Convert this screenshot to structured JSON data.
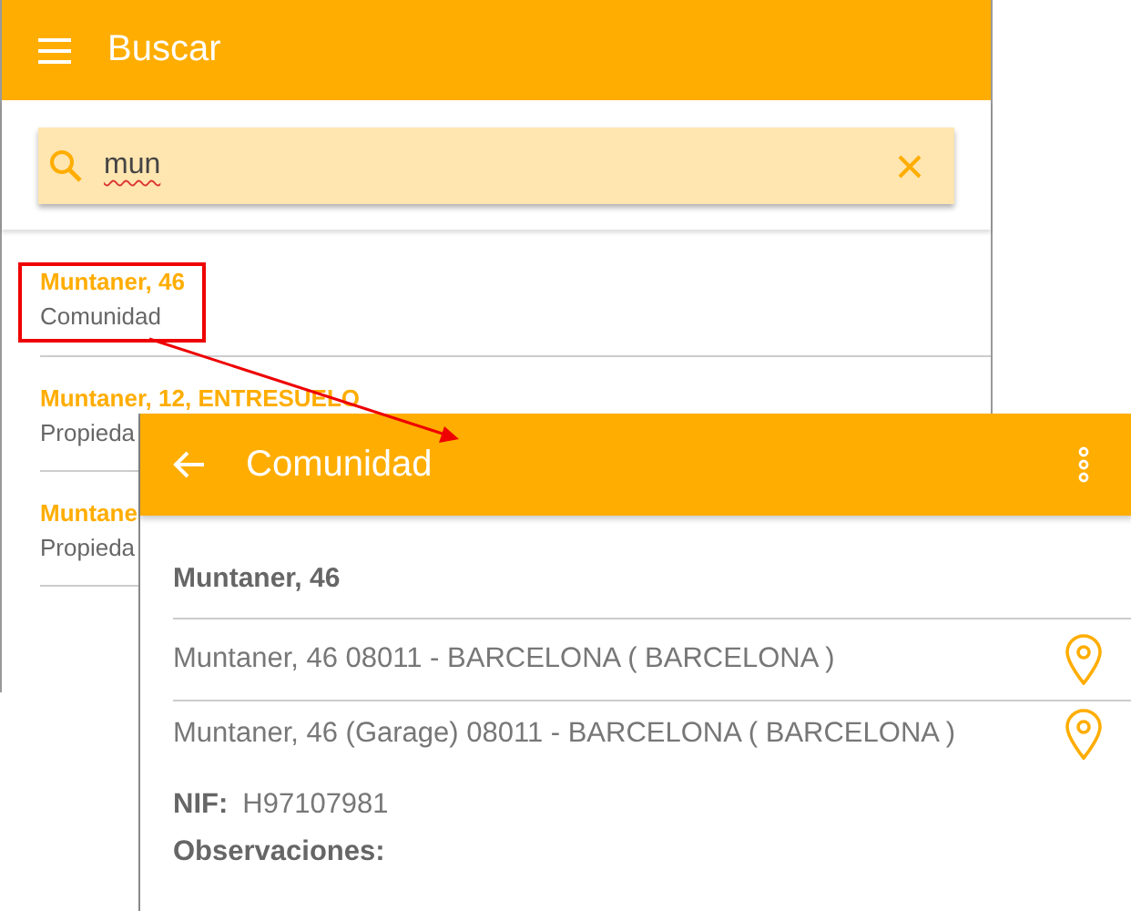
{
  "search_screen": {
    "title": "Buscar",
    "search": {
      "value": "mun"
    },
    "results": [
      {
        "title": "Muntaner, 46",
        "subtitle": "Comunidad",
        "highlighted": true
      },
      {
        "title": "Muntaner, 12, ENTRESUELO",
        "subtitle": "Propieda",
        "highlighted": false
      },
      {
        "title": "Muntane",
        "subtitle": "Propieda",
        "highlighted": false
      }
    ]
  },
  "detail_screen": {
    "title": "Comunidad",
    "name": "Muntaner, 46",
    "addresses": [
      "Muntaner, 46 08011 - BARCELONA ( BARCELONA )",
      "Muntaner, 46 (Garage) 08011 - BARCELONA ( BARCELONA )"
    ],
    "fields": [
      {
        "label": "NIF:",
        "value": "H97107981"
      },
      {
        "label": "Observaciones:"
      }
    ]
  }
}
